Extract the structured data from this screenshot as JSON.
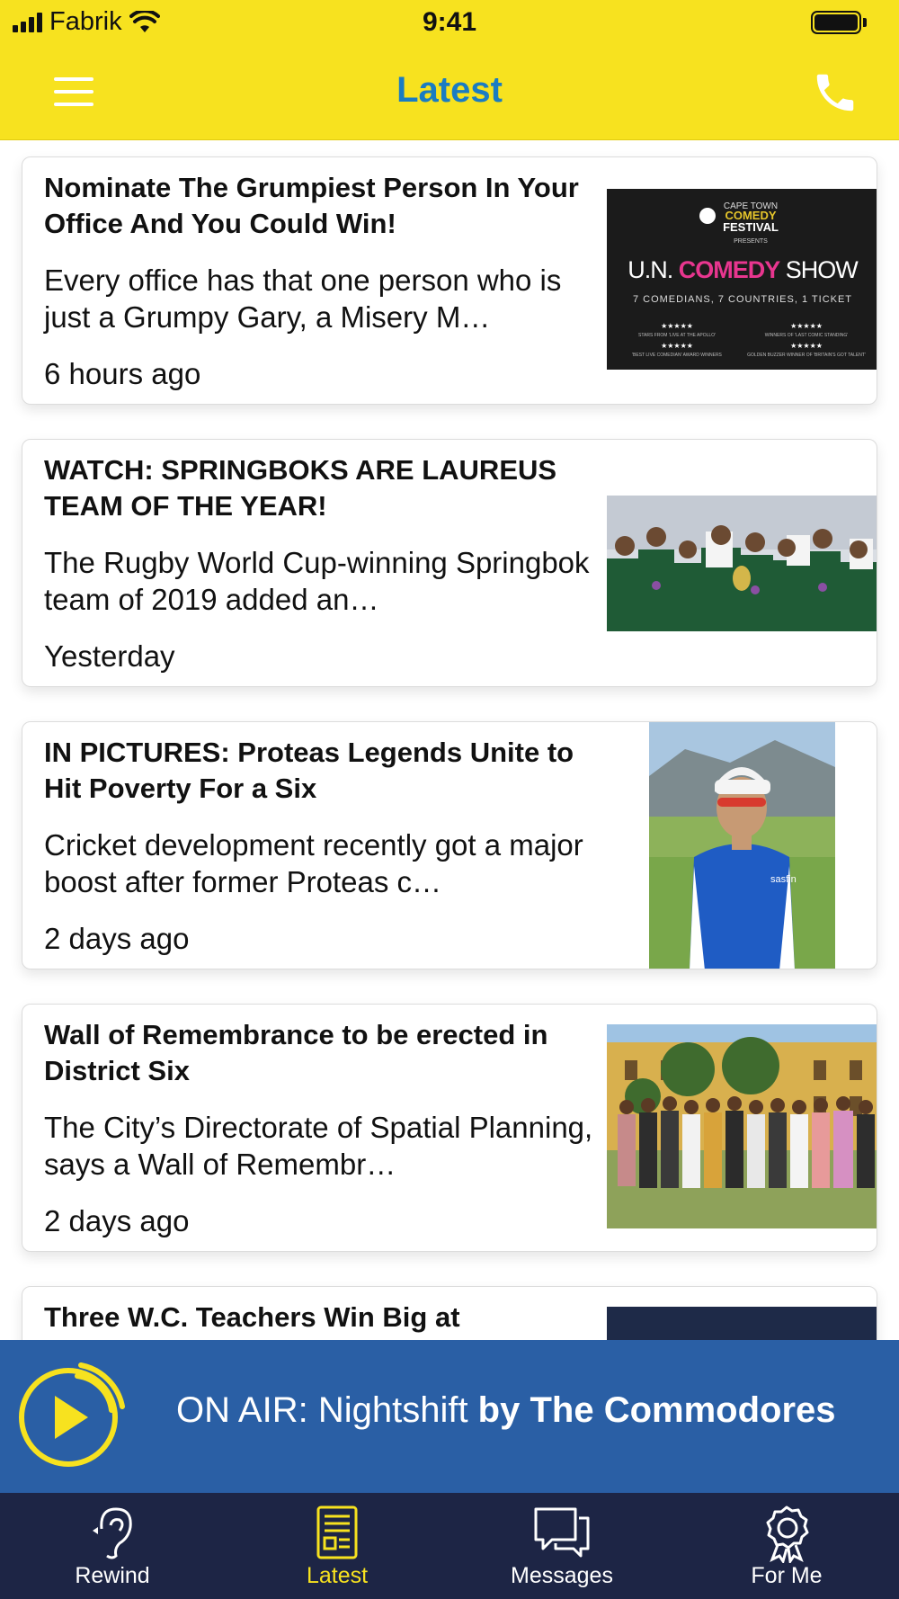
{
  "status_bar": {
    "carrier": "Fabrik",
    "time": "9:41"
  },
  "header": {
    "title": "Latest",
    "menu_icon": "hamburger-menu-icon",
    "call_icon": "phone-icon"
  },
  "articles": [
    {
      "title": "Nominate The Grumpiest Person In Your Office And You Could Win!",
      "summary": "Every office has that one person who is just a Grumpy Gary, a Misery M…",
      "time": "6 hours ago",
      "image": {
        "top_line": "CAPE TOWN",
        "brand1": "COMEDY",
        "brand2": "FESTIVAL",
        "presents": "PRESENTS",
        "show_prefix": "U.N. ",
        "show_name": "COMEDY",
        "show_suffix": " SHOW",
        "tagline": "7 COMEDIANS, 7 COUNTRIES, 1 TICKET",
        "review1": "STARS FROM 'LIVE AT THE APOLLO'",
        "review2": "WINNERS OF 'LAST COMIC STANDING'",
        "review3": "'BEST LIVE COMEDIAN' AWARD WINNERS",
        "review4": "GOLDEN BUZZER WINNER OF 'BRITAIN'S GOT TALENT'",
        "stars": "★★★★★"
      }
    },
    {
      "title": "WATCH: SPRINGBOKS ARE LAUREUS TEAM OF THE YEAR!",
      "summary": "The Rugby World Cup-winning Springbok team of 2019 added an…",
      "time": "Yesterday"
    },
    {
      "title": "IN PICTURES: Proteas Legends Unite to Hit Poverty For a Six",
      "summary": "Cricket development recently got a major boost after former Proteas c…",
      "time": "2 days ago",
      "image": {
        "shirt_logo": "sasfin"
      }
    },
    {
      "title": "Wall of Remembrance to be erected in District Six",
      "summary": "The City’s Directorate of Spatial Planning, says a Wall of Remembr…",
      "time": "2 days ago"
    },
    {
      "title": "Three W.C. Teachers Win Big at",
      "summary": "",
      "time": ""
    }
  ],
  "on_air": {
    "prefix": "ON AIR: Nightshift ",
    "suffix": "by The Commodores",
    "icon": "play-icon"
  },
  "tabs": [
    {
      "label": "Rewind",
      "icon": "ear-icon",
      "active": false
    },
    {
      "label": "Latest",
      "icon": "news-icon",
      "active": true
    },
    {
      "label": "Messages",
      "icon": "chat-bubbles-icon",
      "active": false
    },
    {
      "label": "For Me",
      "icon": "award-badge-icon",
      "active": false
    }
  ],
  "colors": {
    "brand_yellow": "#f7e21f",
    "title_blue": "#1a7cc2",
    "onair_blue": "#2a5fa5",
    "tabbar_navy": "#1d2545"
  }
}
